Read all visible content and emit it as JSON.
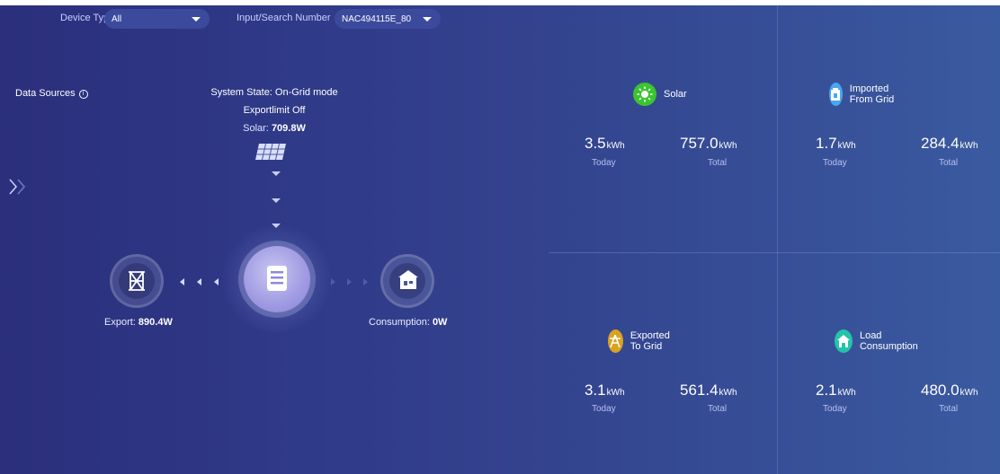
{
  "filters": {
    "device_type_label": "Device Type",
    "device_type_value": "All",
    "search_label": "Input/Search Number",
    "search_value": "NAC494115E_80"
  },
  "data_sources_label": "Data Sources",
  "system": {
    "state": "System State:  On-Grid mode",
    "exportlimit": "Exportlimit Off",
    "solar_label": "Solar:",
    "solar_value": "709.8W"
  },
  "flow": {
    "export_label": "Export:",
    "export_value": "890.4W",
    "consumption_label": "Consumption:",
    "consumption_value": "0W"
  },
  "stats": [
    {
      "title": "Solar",
      "icon": "sun-icon",
      "color": "#3bc42f",
      "today": "3.5",
      "total": "757.0",
      "unit": "kWh",
      "today_label": "Today",
      "total_label": "Total"
    },
    {
      "title": "Imported From Grid",
      "icon": "grid-import-icon",
      "color": "#4aa6f0",
      "today": "1.7",
      "total": "284.4",
      "unit": "kWh",
      "today_label": "Today",
      "total_label": "Total"
    },
    {
      "title": "Exported To Grid",
      "icon": "tower-icon",
      "color": "#d9a21f",
      "today": "3.1",
      "total": "561.4",
      "unit": "kWh",
      "today_label": "Today",
      "total_label": "Total"
    },
    {
      "title": "Load Consumption",
      "icon": "house-icon",
      "color": "#24c4a8",
      "today": "2.1",
      "total": "480.0",
      "unit": "kWh",
      "today_label": "Today",
      "total_label": "Total"
    }
  ]
}
